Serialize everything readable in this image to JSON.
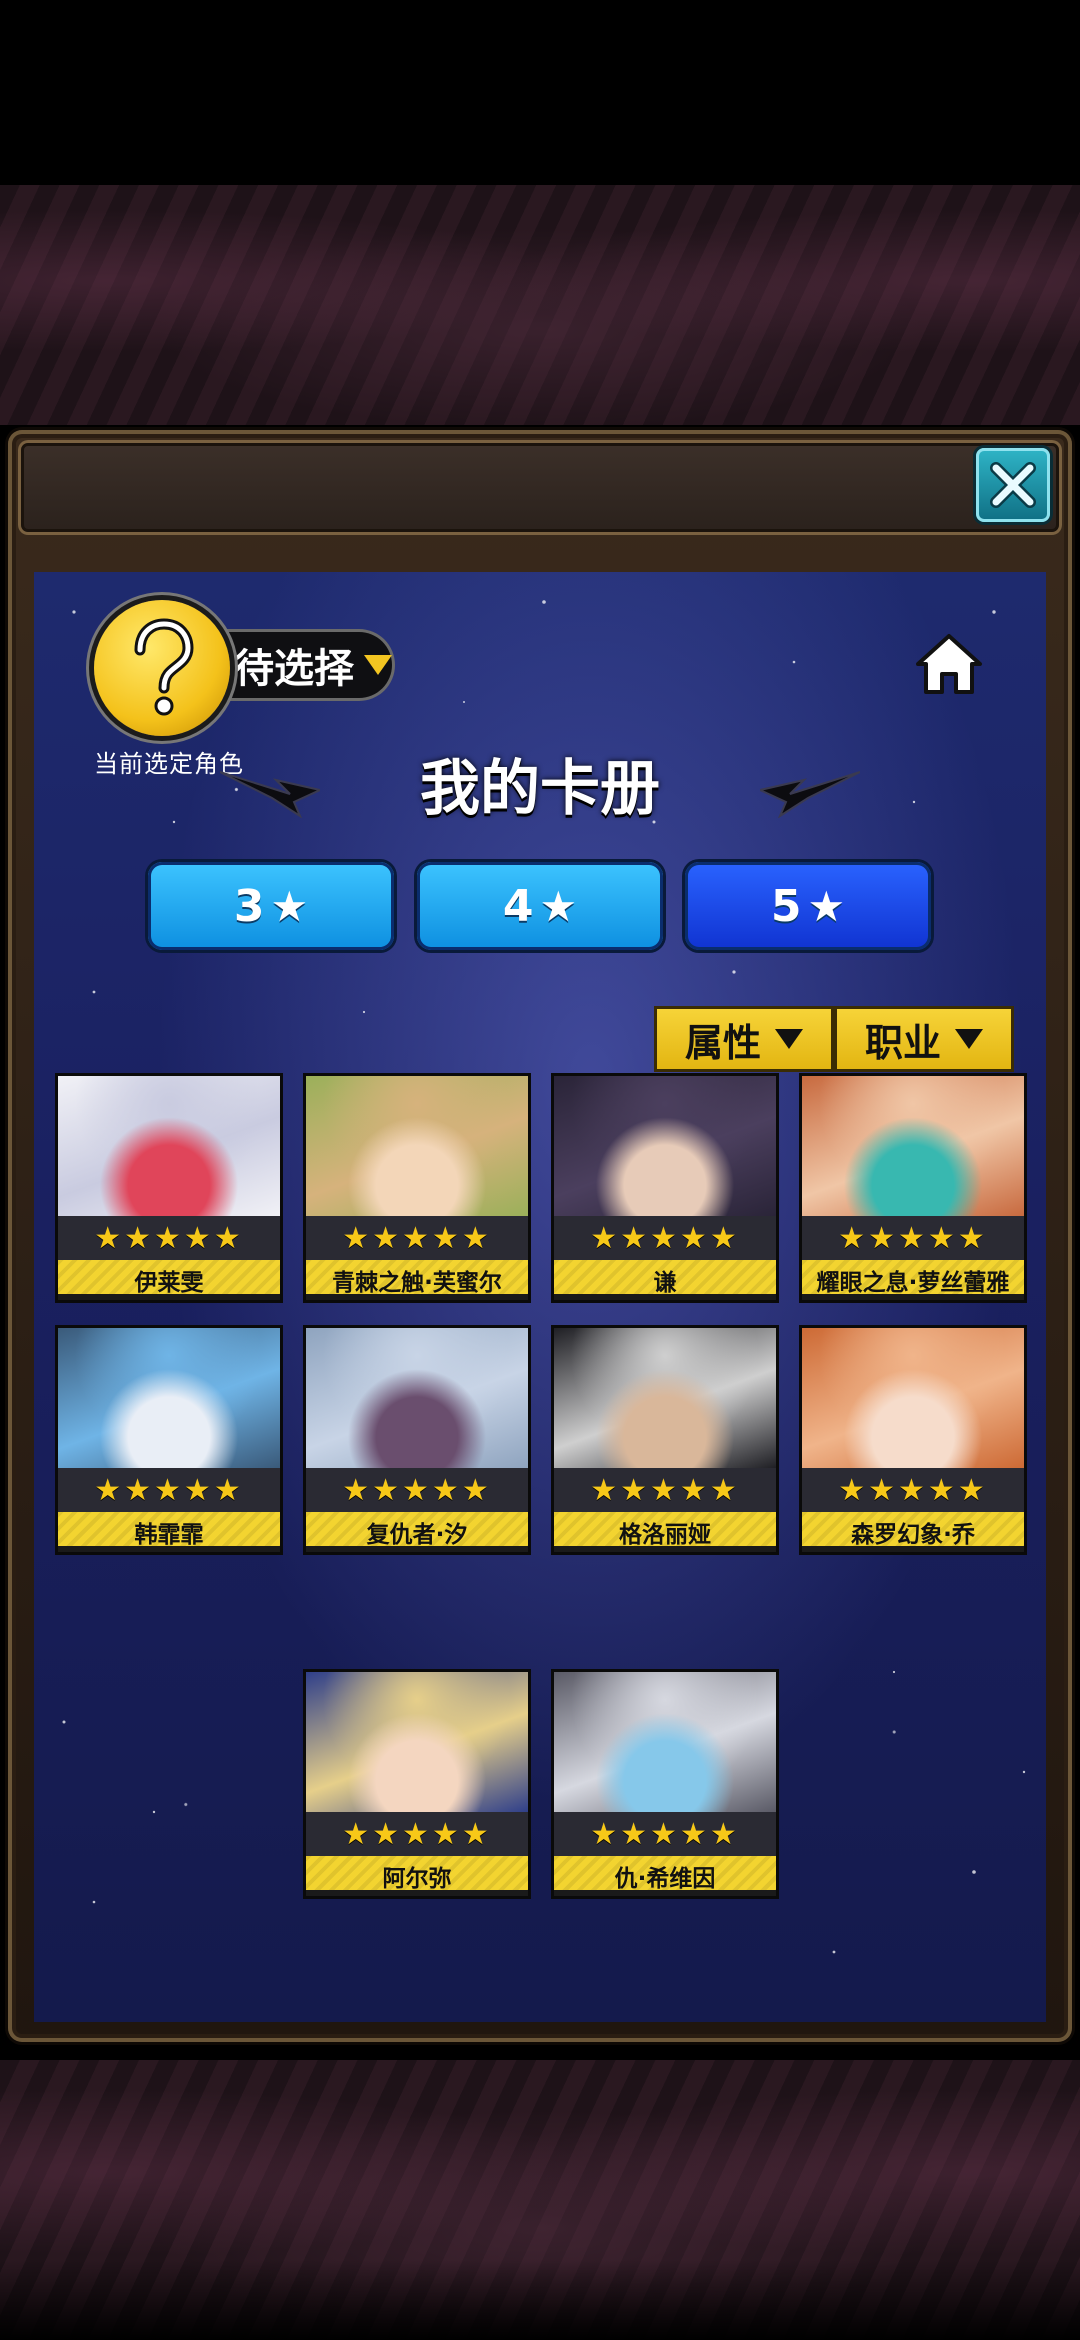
{
  "header": {
    "selected_label": "待选择",
    "selected_caption": "当前选定角色",
    "title": "我的卡册"
  },
  "tabs": [
    {
      "label": "3",
      "active": false
    },
    {
      "label": "4",
      "active": false
    },
    {
      "label": "5",
      "active": true
    }
  ],
  "filters": {
    "attribute": "属性",
    "job": "职业"
  },
  "cards": [
    {
      "name": "伊莱雯",
      "stars": "★★★★★",
      "palette": [
        "#f1f1f6",
        "#c9cbe0",
        "#e0455a"
      ]
    },
    {
      "name": "青棘之触·芙蜜尔",
      "stars": "★★★★★",
      "palette": [
        "#9bb05a",
        "#d6b27c",
        "#f3d6b8"
      ]
    },
    {
      "name": "谦",
      "stars": "★★★★★",
      "palette": [
        "#2a2438",
        "#4b3f5e",
        "#e7cbb8"
      ]
    },
    {
      "name": "耀眼之息·萝丝蕾雅",
      "stars": "★★★★★",
      "palette": [
        "#c86a3f",
        "#f0c6a6",
        "#38b8b0"
      ]
    },
    {
      "name": "韩霏霏",
      "stars": "★★★★★",
      "palette": [
        "#3a5a7a",
        "#6fb4e6",
        "#e9eef6"
      ]
    },
    {
      "name": "复仇者·汐",
      "stars": "★★★★★",
      "palette": [
        "#8fa4bf",
        "#c8d4e6",
        "#6a4e6e"
      ]
    },
    {
      "name": "格洛丽娅",
      "stars": "★★★★★",
      "palette": [
        "#1f1f24",
        "#cfcfcf",
        "#d9b79a"
      ]
    },
    {
      "name": "森罗幻象·乔",
      "stars": "★★★★★",
      "palette": [
        "#cd6a35",
        "#f0b48a",
        "#f6dccb"
      ]
    },
    {
      "name": "阿尔弥",
      "stars": "★★★★★",
      "palette": [
        "#2f3f8a",
        "#e6cf8a",
        "#f4d6c0"
      ]
    },
    {
      "name": "仇·希维因",
      "stars": "★★★★★",
      "palette": [
        "#5a5a66",
        "#d6d8e0",
        "#86c8ea"
      ]
    }
  ],
  "colors": {
    "panel": "#1e2a6e",
    "tab": "#1ea8f2",
    "tab_active": "#1f4df0",
    "filter": "#f3d430",
    "name_strip": "#f3d430",
    "star": "#f7c818"
  }
}
